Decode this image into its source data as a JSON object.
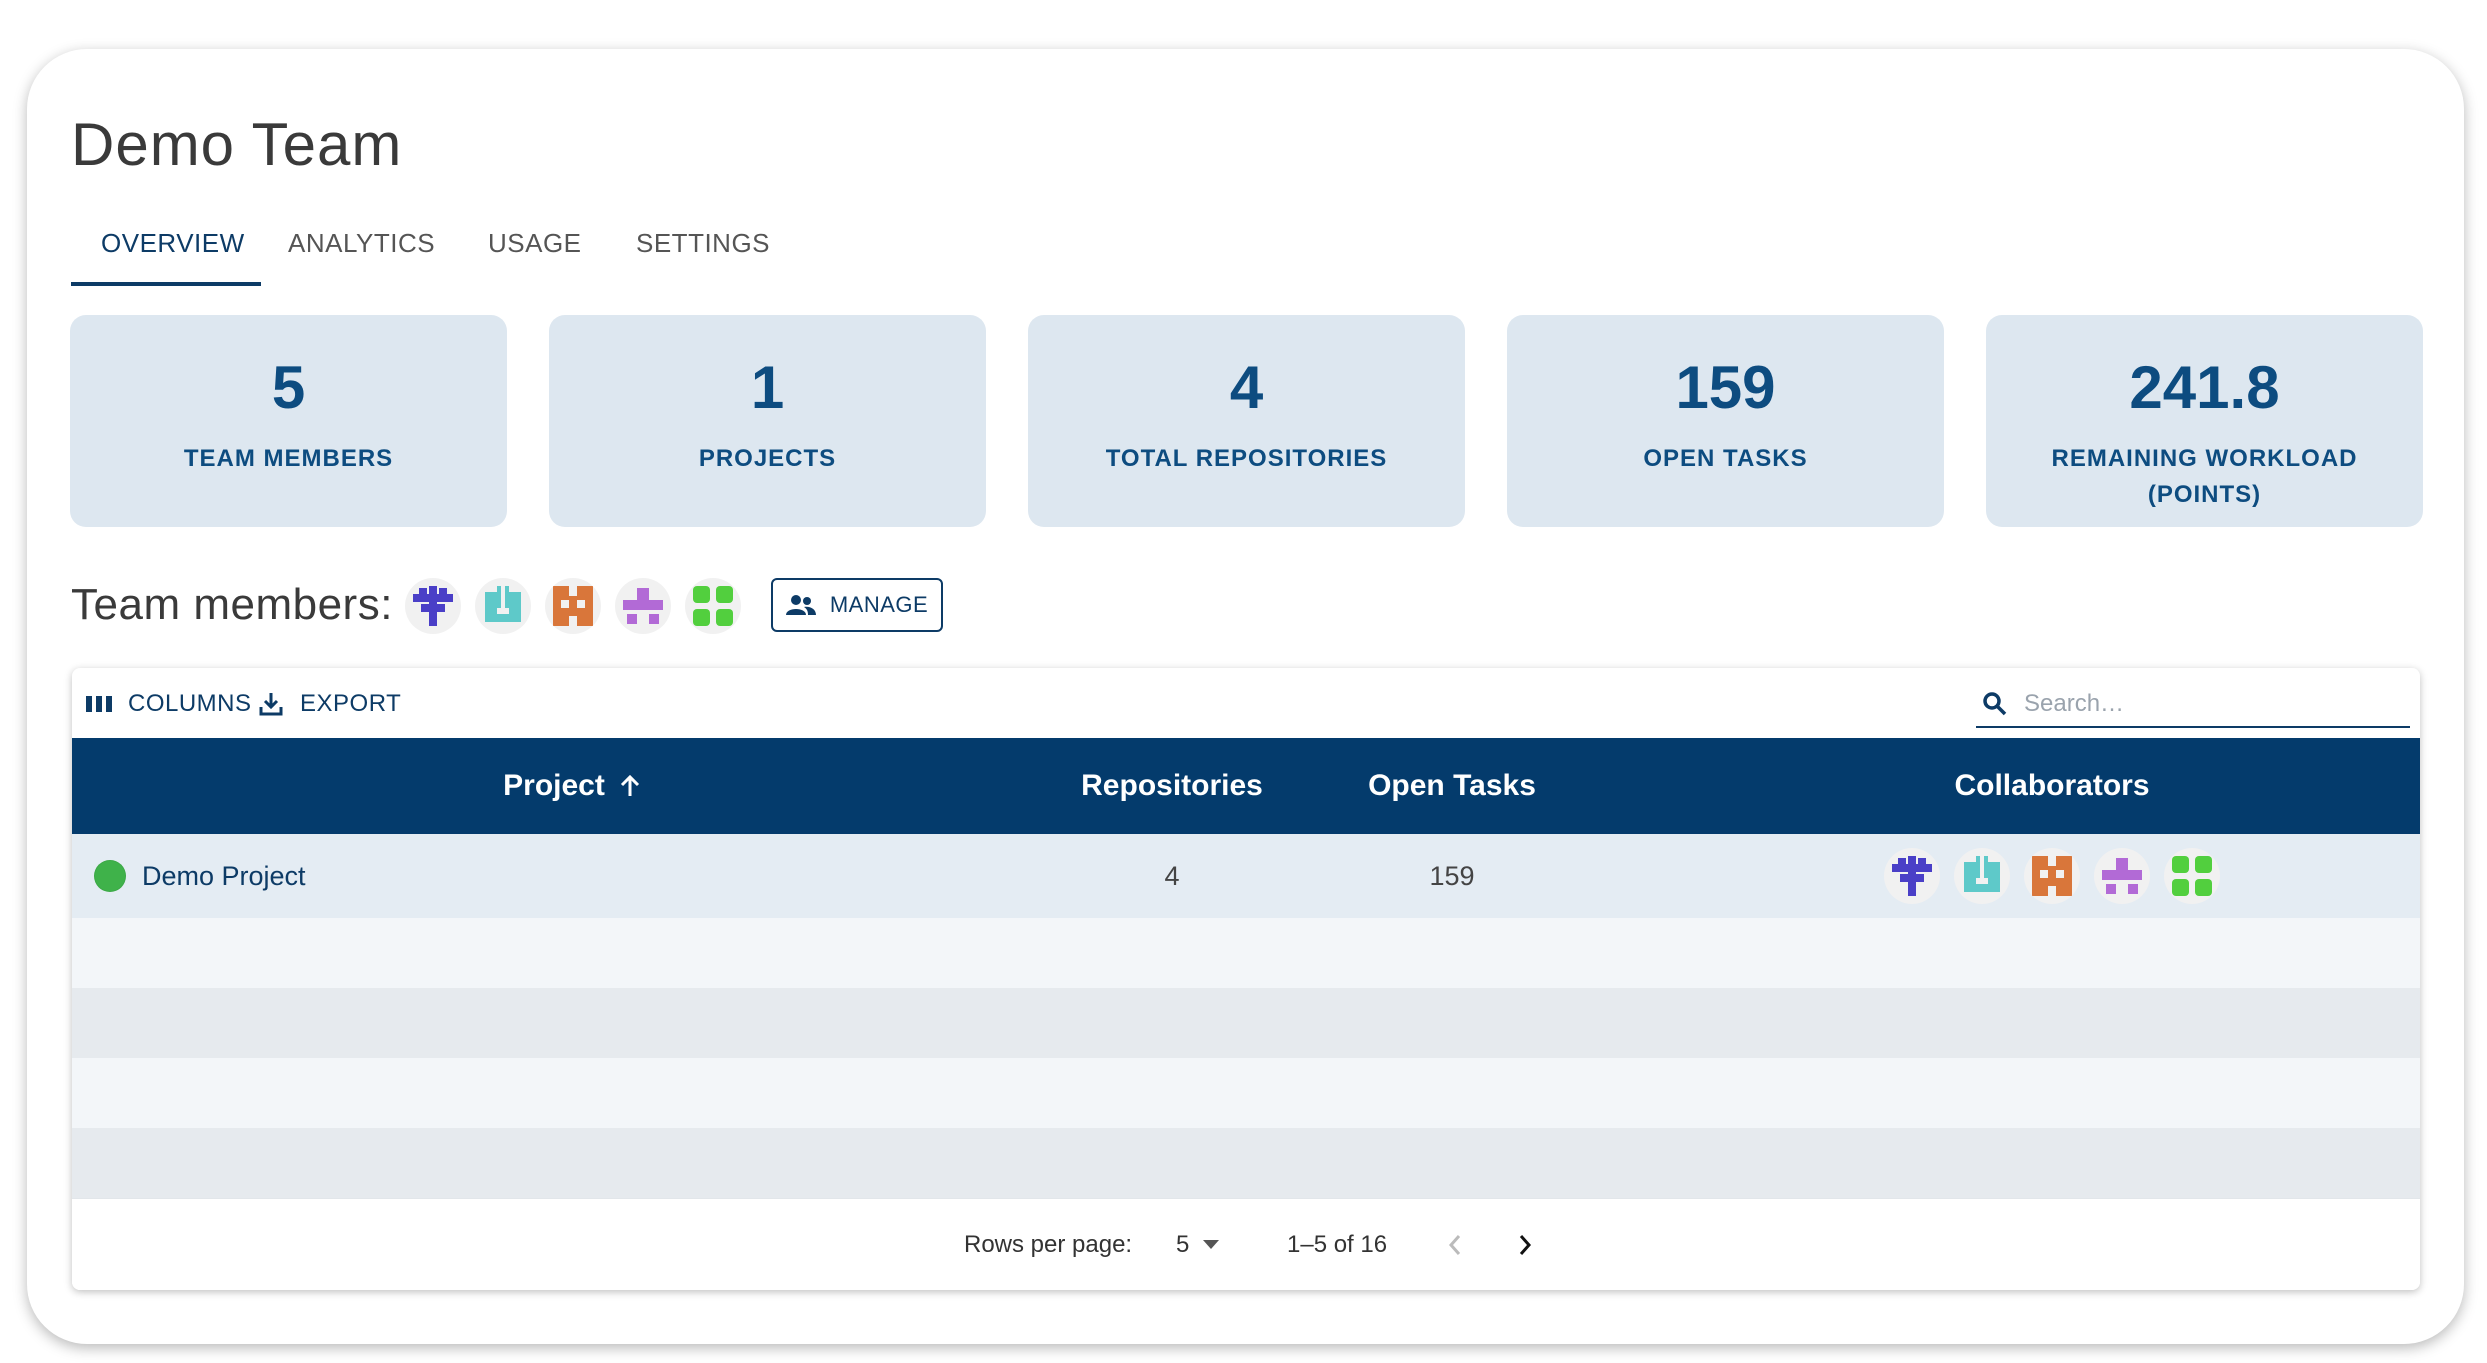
{
  "page": {
    "title": "Demo Team"
  },
  "tabs": [
    {
      "label": "OVERVIEW",
      "active": true
    },
    {
      "label": "ANALYTICS",
      "active": false
    },
    {
      "label": "USAGE",
      "active": false
    },
    {
      "label": "SETTINGS",
      "active": false
    }
  ],
  "stats": [
    {
      "value": "5",
      "label": "TEAM MEMBERS"
    },
    {
      "value": "1",
      "label": "PROJECTS"
    },
    {
      "value": "4",
      "label": "TOTAL REPOSITORIES"
    },
    {
      "value": "159",
      "label": "OPEN TASKS"
    },
    {
      "value": "241.8",
      "label": "REMAINING WORKLOAD (POINTS)"
    }
  ],
  "members": {
    "label": "Team members:",
    "manage_label": "MANAGE",
    "avatar_colors": [
      "#4a3fc7",
      "#5ec9c9",
      "#d9763a",
      "#b26ad6",
      "#52cf3e"
    ]
  },
  "grid": {
    "toolbar": {
      "columns_label": "COLUMNS",
      "export_label": "EXPORT",
      "search_placeholder": "Search…"
    },
    "columns": {
      "project": "Project",
      "repositories": "Repositories",
      "open_tasks": "Open Tasks",
      "collaborators": "Collaborators"
    },
    "rows": [
      {
        "project": "Demo Project",
        "repositories": "4",
        "open_tasks": "159",
        "status_color": "#3fb24a"
      }
    ],
    "footer": {
      "rows_per_page_label": "Rows per page:",
      "rows_per_page_value": "5",
      "range": "1–5 of 16"
    }
  },
  "colors": {
    "primary": "#0d3b66",
    "header_bg": "#043b6c",
    "stat_bg": "#dde7f0",
    "stat_text": "#0d4c80",
    "status_green": "#3fb24a"
  }
}
